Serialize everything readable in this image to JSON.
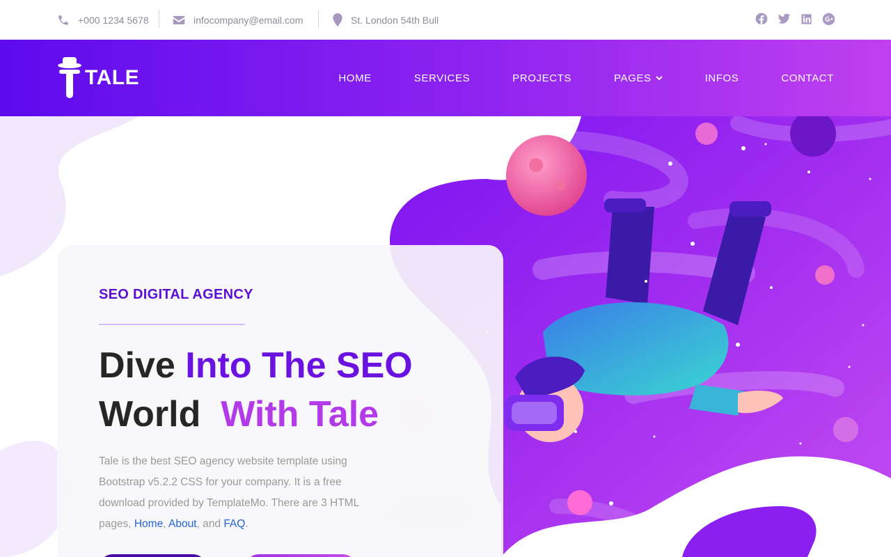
{
  "topbar": {
    "phone": "+000 1234 5678",
    "email": "infocompany@email.com",
    "address": "St. London 54th Bull",
    "social_icons": [
      "facebook-icon",
      "twitter-icon",
      "linkedin-icon",
      "google-plus-icon"
    ]
  },
  "brand": {
    "name": "TALE"
  },
  "nav": {
    "items": [
      "HOME",
      "SERVICES",
      "PROJECTS",
      "PAGES",
      "INFOS",
      "CONTACT"
    ]
  },
  "hero": {
    "kicker": "SEO DIGITAL AGENCY",
    "title_part1": "Dive",
    "title_part2": "Into The SEO",
    "title_part3": "World",
    "title_part4": "With Tale",
    "desc_intro": "Tale is the best SEO agency website template using Bootstrap v5.2.2 CSS for your company. It is a free download provided by TemplateMo. There are 3 HTML pages,",
    "link_home": "Home",
    "link_about": "About",
    "link_faq": "FAQ",
    "desc_and": "and",
    "desc_end": "."
  },
  "colors": {
    "primary": "#5d0bee",
    "accent": "#b23ae8",
    "dark_text": "#262626",
    "link": "#2563d8"
  }
}
